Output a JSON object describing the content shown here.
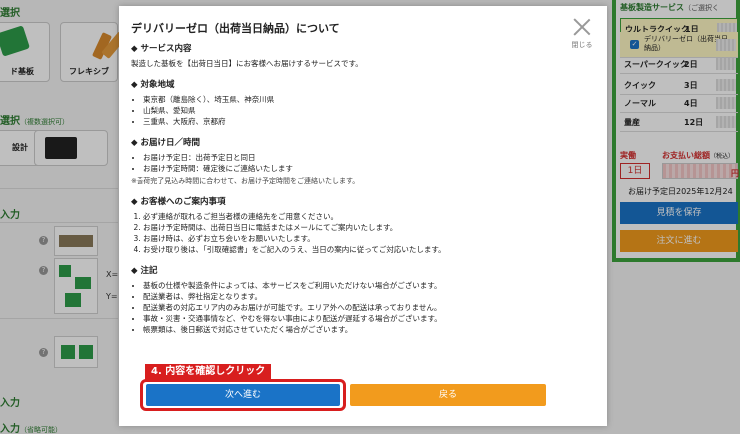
{
  "background": {
    "left": {
      "section1_title": "選択",
      "tiles": [
        {
          "label": "ド基板"
        },
        {
          "label": "フレキシブ"
        }
      ],
      "section2_title": "選択",
      "section2_sub": "（複数選択可）",
      "design_label": "設計",
      "section3_title": "入力",
      "coord_x": "X=",
      "coord_y": "Y=",
      "section4_title": "入力",
      "section5_title": "入力",
      "section5_sub": "（省略可能）"
    },
    "right": {
      "panel_title": "基板製造サービス",
      "panel_sub": "（ご選択く",
      "options": [
        {
          "name": "ウルトラクイック",
          "days": "1日"
        },
        {
          "name": "スーパークイック",
          "days": "2日"
        },
        {
          "name": "クイック",
          "days": "3日"
        },
        {
          "name": "ノーマル",
          "days": "4日"
        },
        {
          "name": "量産",
          "days": "12日"
        }
      ],
      "suboption_label": "デリバリーゼロ（出荷当日納品）",
      "actual_label": "実働",
      "total_label": "お支払い総額",
      "total_sub": "（税込）",
      "day_value": "1日",
      "yen": "円",
      "delivery_date": "お届け予定日2025年12月24",
      "save_button": "見積を保存",
      "order_button": "注文に進む"
    }
  },
  "modal": {
    "title": "デリバリーゼロ（出荷当日納品）について",
    "close_label": "閉じる",
    "sections": {
      "service": {
        "heading": "◆ サービス内容",
        "text": "製造した基板を【出荷日当日】にお客様へお届けするサービスです。"
      },
      "area": {
        "heading": "◆ 対象地域",
        "items": [
          "東京都（離島除く）、埼玉県、神奈川県",
          "山梨県、愛知県",
          "三重県、大阪府、京都府"
        ]
      },
      "delivery": {
        "heading": "◆ お届け日／時間",
        "items": [
          "お届け予定日：出荷予定日と同日",
          "お届け予定時間：確定後にご連絡いたします"
        ],
        "note": "※출荷完了見込み時間に合わせて、お届け予定時間をご連絡いたします。"
      },
      "guidance": {
        "heading": "◆ お客様へのご案内事項",
        "items": [
          "必ず連絡が取れるご担当者様の連絡先をご用意ください。",
          "お届け予定時間は、出荷日当日に電話またはメールにてご案内いたします。",
          "お届け時は、必ずお立ち会いをお願いいたします。",
          "お受け取り後は、「引取確認書」をご記入のうえ、当日の案内に従ってご対応いたします。"
        ]
      },
      "caution": {
        "heading": "◆ 注記",
        "items": [
          "基板の仕様や製造条件によっては、本サービスをご利用いただけない場合がございます。",
          "配送業者は、弊社指定となります。",
          "配送業者の対応エリア内のみお届けが可能です。エリア外への配送は承っておりません。",
          "事故・災害・交通事情など、やむを得ない事由により配送が遅延する場合がございます。",
          "帳票類は、後日郵送で対応させていただく場合がございます。"
        ]
      }
    },
    "annotation": "4. 内容を確認しクリック",
    "next_button": "次へ進む",
    "back_button": "戻る"
  }
}
